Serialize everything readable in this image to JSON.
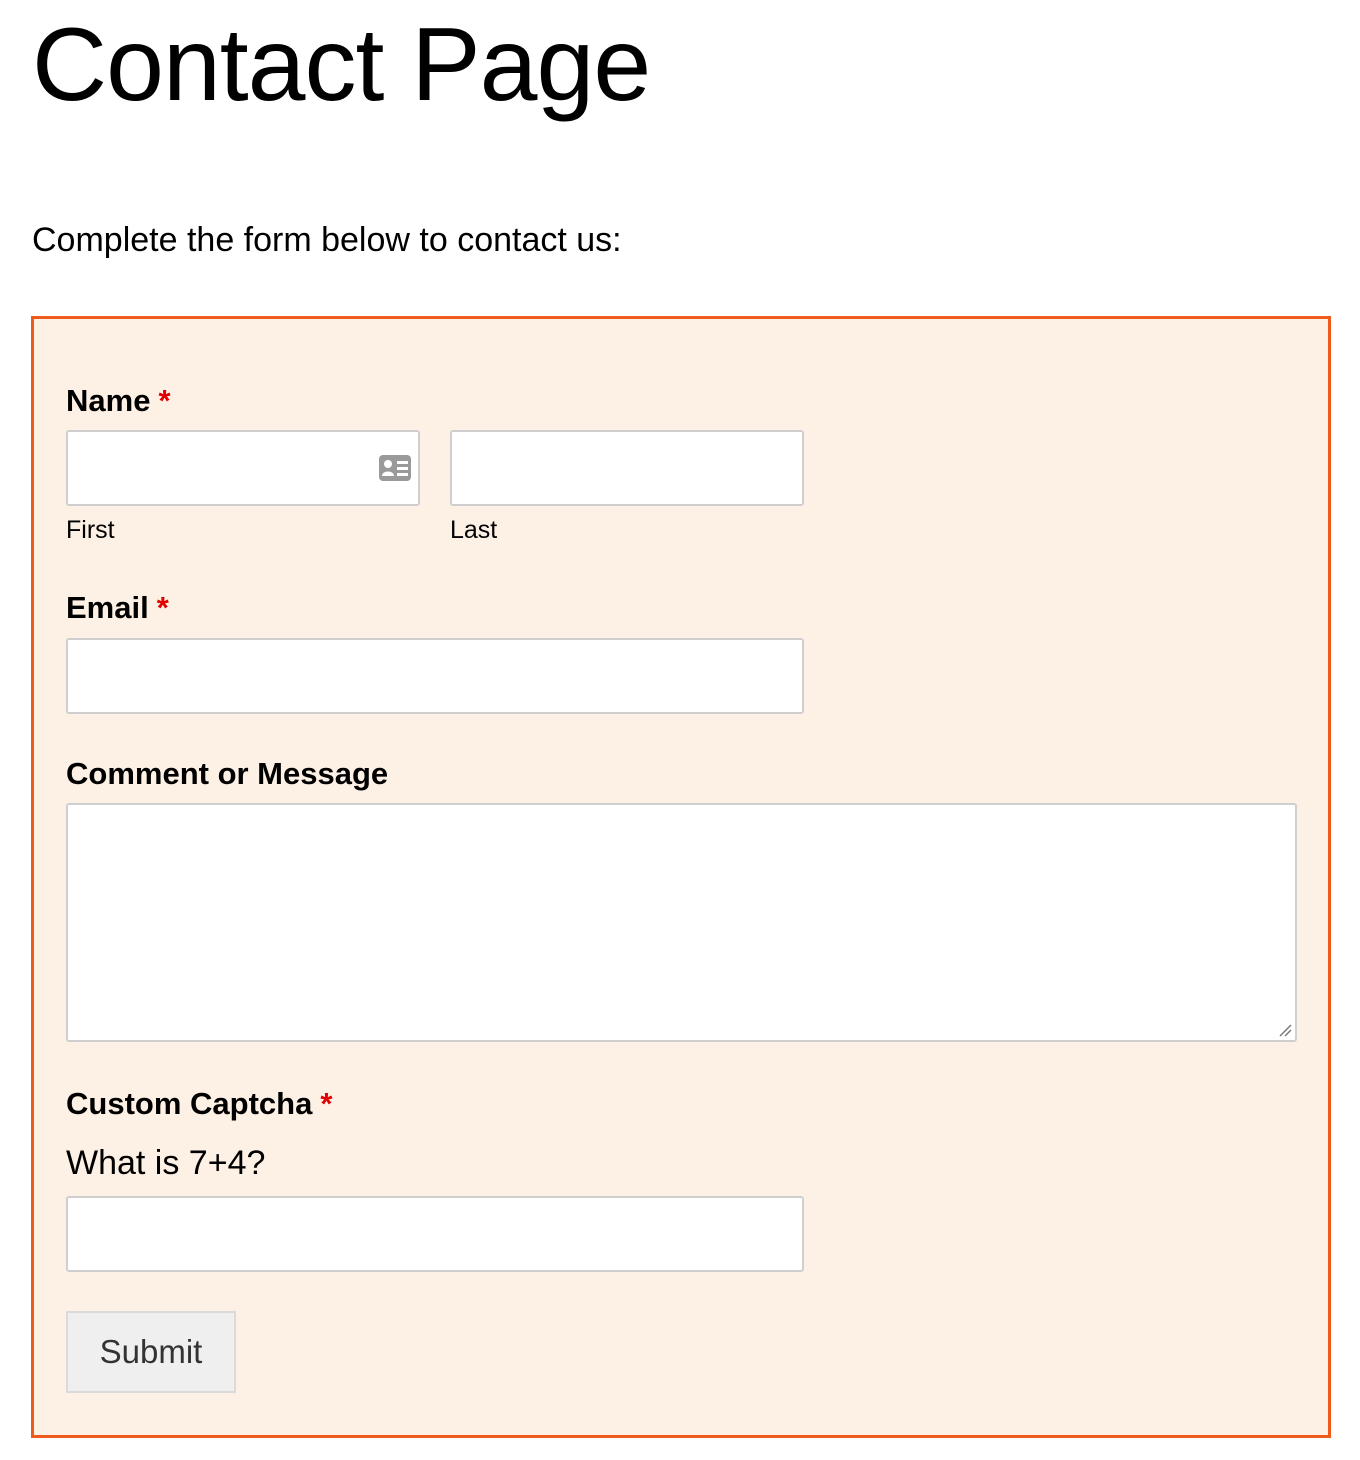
{
  "page": {
    "title": "Contact Page",
    "intro": "Complete the form below to contact us:"
  },
  "form": {
    "accent_color": "#f05a1a",
    "background_color": "#fdf0e4",
    "required_marker": "*",
    "name": {
      "label": "Name",
      "first": {
        "value": "",
        "sublabel": "First",
        "icon": "contact-card-icon"
      },
      "last": {
        "value": "",
        "sublabel": "Last"
      }
    },
    "email": {
      "label": "Email",
      "value": ""
    },
    "message": {
      "label": "Comment or Message",
      "value": ""
    },
    "captcha": {
      "label": "Custom Captcha",
      "question": "What is 7+4?",
      "value": ""
    },
    "submit_label": "Submit"
  }
}
